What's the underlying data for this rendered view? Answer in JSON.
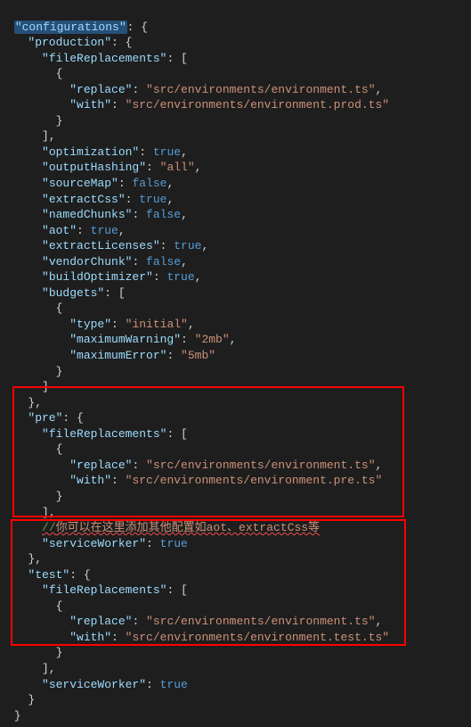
{
  "keys": {
    "configurations": "\"configurations\"",
    "production": "\"production\"",
    "fileReplacements": "\"fileReplacements\"",
    "replace": "\"replace\"",
    "with": "\"with\"",
    "optimization": "\"optimization\"",
    "outputHashing": "\"outputHashing\"",
    "sourceMap": "\"sourceMap\"",
    "extractCss": "\"extractCss\"",
    "namedChunks": "\"namedChunks\"",
    "aot": "\"aot\"",
    "extractLicenses": "\"extractLicenses\"",
    "vendorChunk": "\"vendorChunk\"",
    "buildOptimizer": "\"buildOptimizer\"",
    "budgets": "\"budgets\"",
    "type": "\"type\"",
    "maximumWarning": "\"maximumWarning\"",
    "maximumError": "\"maximumError\"",
    "pre": "\"pre\"",
    "serviceWorker": "\"serviceWorker\"",
    "test": "\"test\""
  },
  "values": {
    "envTs": "\"src/environments/environment.ts\"",
    "envProdTs": "\"src/environments/environment.prod.ts\"",
    "envPreTs": "\"src/environments/environment.pre.ts\"",
    "envTestTs": "\"src/environments/environment.test.ts\"",
    "all": "\"all\"",
    "initial": "\"initial\"",
    "mb2": "\"2mb\"",
    "mb5": "\"5mb\"",
    "true": "true",
    "false": "false"
  },
  "comment": {
    "slashes": "//",
    "text": "你可以在这里添加其他配置如aot、extractCss等"
  }
}
